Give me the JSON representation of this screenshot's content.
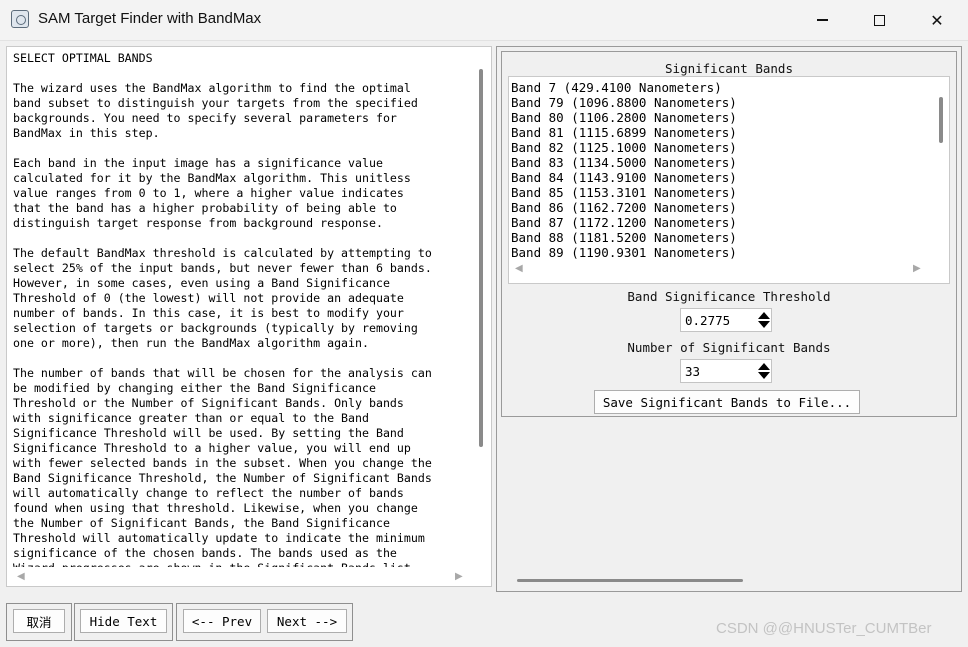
{
  "window": {
    "title": "SAM Target Finder with BandMax",
    "icon": "app-icon",
    "controls": [
      "minimize-icon",
      "maximize-icon",
      "close-icon"
    ]
  },
  "instructions": {
    "lines": [
      "SELECT OPTIMAL BANDS",
      "",
      "The wizard uses the BandMax algorithm to find the optimal",
      "band subset to distinguish your targets from the specified",
      "backgrounds. You need to specify several parameters for",
      "BandMax in this step.",
      "",
      "Each band in the input image has a significance value",
      "calculated for it by the BandMax algorithm. This unitless",
      "value ranges from 0 to 1, where a higher value indicates",
      "that the band has a higher probability of being able to",
      "distinguish target response from background response.",
      "",
      "The default BandMax threshold is calculated by attempting to",
      "select 25% of the input bands, but never fewer than 6 bands.",
      "However, in some cases, even using a Band Significance",
      "Threshold of 0 (the lowest) will not provide an adequate",
      "number of bands. In this case, it is best to modify your",
      "selection of targets or backgrounds (typically by removing",
      "one or more), then run the BandMax algorithm again.",
      "",
      "The number of bands that will be chosen for the analysis can",
      "be modified by changing either the Band Significance",
      "Threshold or the Number of Significant Bands. Only bands",
      "with significance greater than or equal to the Band",
      "Significance Threshold will be used. By setting the Band",
      "Significance Threshold to a higher value, you will end up",
      "with fewer selected bands in the subset. When you change the",
      "Band Significance Threshold, the Number of Significant Bands",
      "will automatically change to reflect the number of bands",
      "found when using that threshold. Likewise, when you change",
      "the Number of Significant Bands, the Band Significance",
      "Threshold will automatically update to indicate the minimum",
      "significance of the chosen bands. The bands used as the",
      "Wizard progresses are shown in the Significant Bands list."
    ]
  },
  "significant_bands": {
    "label": "Significant Bands",
    "items": [
      "Band 7 (429.4100 Nanometers)",
      "Band 79 (1096.8800 Nanometers)",
      "Band 80 (1106.2800 Nanometers)",
      "Band 81 (1115.6899 Nanometers)",
      "Band 82 (1125.1000 Nanometers)",
      "Band 83 (1134.5000 Nanometers)",
      "Band 84 (1143.9100 Nanometers)",
      "Band 85 (1153.3101 Nanometers)",
      "Band 86 (1162.7200 Nanometers)",
      "Band 87 (1172.1200 Nanometers)",
      "Band 88 (1181.5200 Nanometers)",
      "Band 89 (1190.9301 Nanometers)"
    ]
  },
  "threshold": {
    "label": "Band Significance Threshold",
    "value": "0.2775"
  },
  "num_bands": {
    "label": "Number of Significant Bands",
    "value": "33"
  },
  "save_button": "Save Significant Bands to File...",
  "footer": {
    "cancel": "取消",
    "hide_text": "Hide Text",
    "prev": "<-- Prev",
    "next": "Next -->"
  },
  "watermark": "CSDN @@HNUSTer_CUMTBer"
}
